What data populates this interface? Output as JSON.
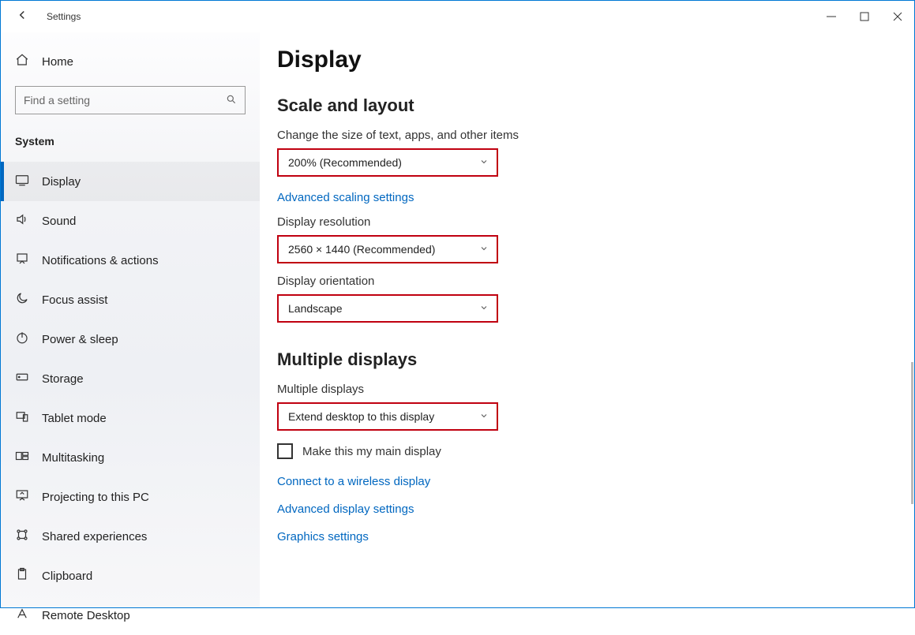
{
  "titlebar": {
    "app_title": "Settings"
  },
  "sidebar": {
    "home_label": "Home",
    "search_placeholder": "Find a setting",
    "group_label": "System",
    "items": [
      {
        "label": "Display",
        "active": true
      },
      {
        "label": "Sound"
      },
      {
        "label": "Notifications & actions"
      },
      {
        "label": "Focus assist"
      },
      {
        "label": "Power & sleep"
      },
      {
        "label": "Storage"
      },
      {
        "label": "Tablet mode"
      },
      {
        "label": "Multitasking"
      },
      {
        "label": "Projecting to this PC"
      },
      {
        "label": "Shared experiences"
      },
      {
        "label": "Clipboard"
      },
      {
        "label": "Remote Desktop"
      }
    ]
  },
  "main": {
    "page_title": "Display",
    "section_scale": "Scale and layout",
    "scale_label": "Change the size of text, apps, and other items",
    "scale_value": "200% (Recommended)",
    "advanced_scaling_link": "Advanced scaling settings",
    "resolution_label": "Display resolution",
    "resolution_value": "2560 × 1440 (Recommended)",
    "orientation_label": "Display orientation",
    "orientation_value": "Landscape",
    "section_multiple": "Multiple displays",
    "multiple_label": "Multiple displays",
    "multiple_value": "Extend desktop to this display",
    "main_display_checkbox": "Make this my main display",
    "link_wireless": "Connect to a wireless display",
    "link_advanced_display": "Advanced display settings",
    "link_graphics": "Graphics settings"
  }
}
